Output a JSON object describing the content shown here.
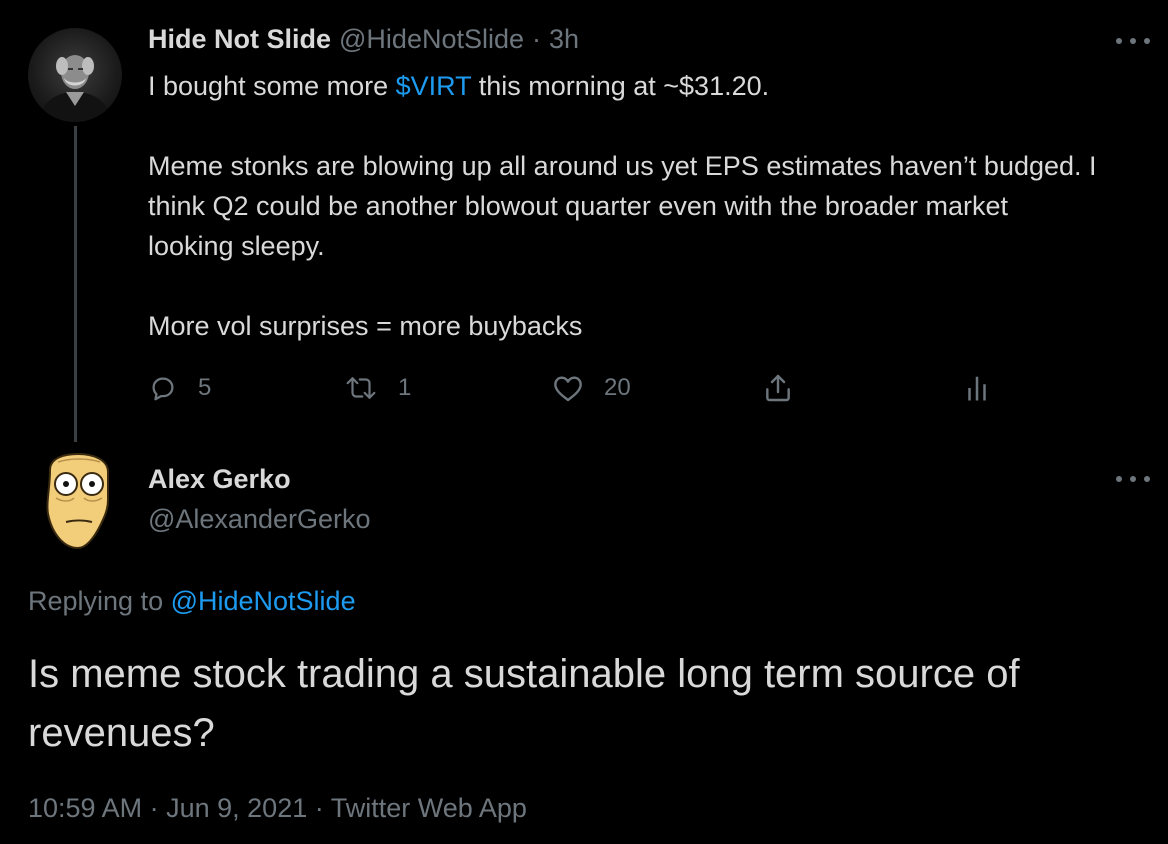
{
  "colors": {
    "background": "#000000",
    "text_primary": "#d9d9d9",
    "text_secondary": "#6e767d",
    "link": "#1d9bf0",
    "thread_line": "#3a3f44"
  },
  "parent_tweet": {
    "author_name": "Hide Not Slide",
    "author_handle": "@HideNotSlide",
    "separator": "·",
    "time": "3h",
    "more_icon": "more-horizontal-icon",
    "body": {
      "line1_before": "I bought some more ",
      "cashtag": "$VIRT",
      "line1_after": " this morning at ~$31.20.",
      "paragraph2": "Meme stonks are blowing up all around us yet EPS estimates haven’t budged.  I think Q2 could be another blowout quarter even with the broader market looking sleepy.",
      "paragraph3": "More vol surprises = more buybacks"
    },
    "actions": {
      "reply": {
        "icon": "reply-icon",
        "count": "5"
      },
      "retweet": {
        "icon": "retweet-icon",
        "count": "1"
      },
      "like": {
        "icon": "heart-icon",
        "count": "20"
      },
      "share": {
        "icon": "share-icon"
      },
      "analytics": {
        "icon": "analytics-icon"
      }
    }
  },
  "reply_tweet": {
    "author_name": "Alex Gerko",
    "author_handle": "@AlexanderGerko",
    "more_icon": "more-horizontal-icon",
    "replying_to_label": "Replying to ",
    "replying_to_handle": "@HideNotSlide",
    "body": "Is meme stock trading a sustainable long term source of revenues?",
    "timestamp": "10:59 AM",
    "separator1": "·",
    "date": "Jun 9, 2021",
    "separator2": "·",
    "source": "Twitter Web App"
  }
}
